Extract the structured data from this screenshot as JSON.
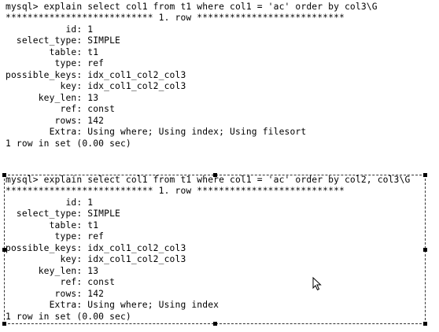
{
  "terminal": {
    "block1": {
      "command": "mysql> explain select col1 from t1 where col1 = 'ac' order by col3\\G",
      "row_header": "*************************** 1. row ***************************",
      "fields": [
        "           id: 1",
        "  select_type: SIMPLE",
        "        table: t1",
        "         type: ref",
        "possible_keys: idx_col1_col2_col3",
        "          key: idx_col1_col2_col3",
        "      key_len: 13",
        "          ref: const",
        "         rows: 142",
        "        Extra: Using where; Using index; Using filesort"
      ],
      "footer": "1 row in set (0.00 sec)"
    },
    "block2": {
      "command": "mysql> explain select col1 from t1 where col1 = 'ac' order by col2, col3\\G",
      "row_header": "*************************** 1. row ***************************",
      "fields": [
        "           id: 1",
        "  select_type: SIMPLE",
        "        table: t1",
        "         type: ref",
        "possible_keys: idx_col1_col2_col3",
        "          key: idx_col1_col2_col3",
        "      key_len: 13",
        "          ref: const",
        "         rows: 142",
        "        Extra: Using where; Using index"
      ],
      "footer": "1 row in set (0.00 sec)"
    }
  },
  "cursor_icon": "mouse-pointer-icon"
}
